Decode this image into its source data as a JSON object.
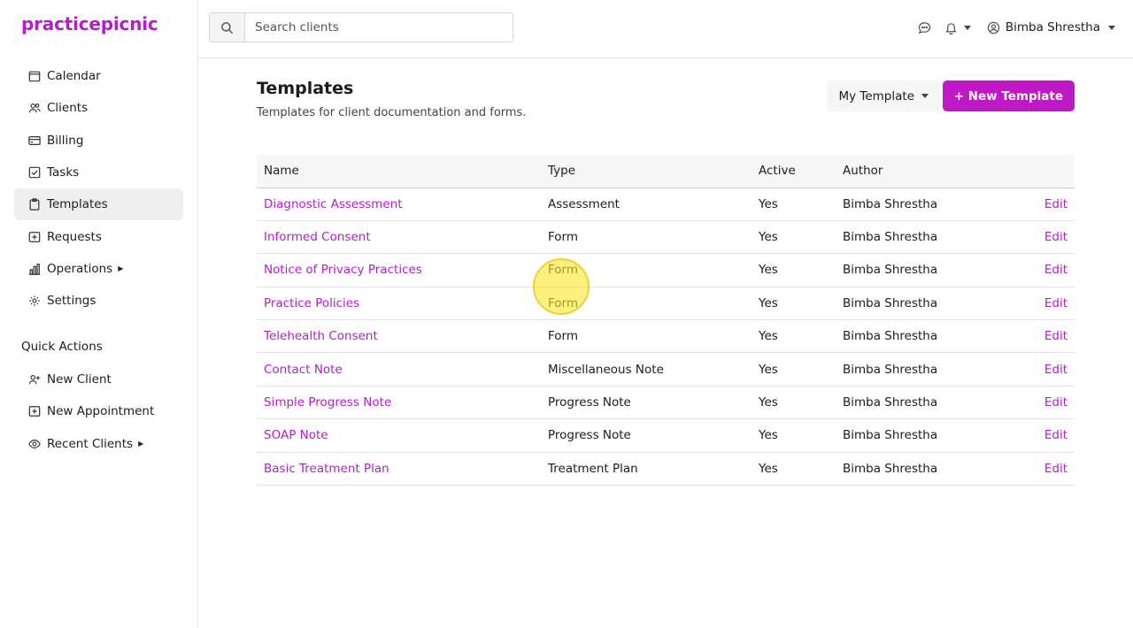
{
  "app": {
    "logo": "practicepicnic"
  },
  "sidebar": {
    "items": [
      {
        "label": "Calendar",
        "icon": "calendar-icon"
      },
      {
        "label": "Clients",
        "icon": "users-icon"
      },
      {
        "label": "Billing",
        "icon": "credit-card-icon"
      },
      {
        "label": "Tasks",
        "icon": "checkbox-icon"
      },
      {
        "label": "Templates",
        "icon": "clipboard-icon",
        "active": true
      },
      {
        "label": "Requests",
        "icon": "inbox-icon"
      },
      {
        "label": "Operations",
        "icon": "bar-chart-icon",
        "has_submenu": true
      },
      {
        "label": "Settings",
        "icon": "gear-icon"
      }
    ],
    "quick_actions": {
      "title": "Quick Actions",
      "items": [
        {
          "label": "New Client",
          "icon": "add-user-icon"
        },
        {
          "label": "New Appointment",
          "icon": "calendar-plus-icon"
        },
        {
          "label": "Recent Clients",
          "icon": "eye-icon",
          "has_submenu": true
        }
      ]
    }
  },
  "topbar": {
    "search": {
      "placeholder": "Search clients",
      "value": ""
    },
    "user_name": "Bimba Shrestha"
  },
  "main": {
    "title": "Templates",
    "subtitle": "Templates for client documentation and forms.",
    "filter_label": "My Template",
    "new_button": "+ New Template"
  },
  "table": {
    "headers": [
      "Name",
      "Type",
      "Active",
      "Author",
      ""
    ],
    "rows": [
      {
        "name": "Diagnostic Assessment",
        "type": "Assessment",
        "active": "Yes",
        "author": "Bimba Shrestha",
        "action": "Edit"
      },
      {
        "name": "Informed Consent",
        "type": "Form",
        "active": "Yes",
        "author": "Bimba Shrestha",
        "action": "Edit"
      },
      {
        "name": "Notice of Privacy Practices",
        "type": "Form",
        "active": "Yes",
        "author": "Bimba Shrestha",
        "action": "Edit"
      },
      {
        "name": "Practice Policies",
        "type": "Form",
        "active": "Yes",
        "author": "Bimba Shrestha",
        "action": "Edit"
      },
      {
        "name": "Telehealth Consent",
        "type": "Form",
        "active": "Yes",
        "author": "Bimba Shrestha",
        "action": "Edit"
      },
      {
        "name": "Contact Note",
        "type": "Miscellaneous Note",
        "active": "Yes",
        "author": "Bimba Shrestha",
        "action": "Edit"
      },
      {
        "name": "Simple Progress Note",
        "type": "Progress Note",
        "active": "Yes",
        "author": "Bimba Shrestha",
        "action": "Edit"
      },
      {
        "name": "SOAP Note",
        "type": "Progress Note",
        "active": "Yes",
        "author": "Bimba Shrestha",
        "action": "Edit"
      },
      {
        "name": "Basic Treatment Plan",
        "type": "Treatment Plan",
        "active": "Yes",
        "author": "Bimba Shrestha",
        "action": "Edit"
      }
    ]
  },
  "colors": {
    "brand": "#b31ec9",
    "button": "#c018c7",
    "active_nav": "#efefef"
  }
}
